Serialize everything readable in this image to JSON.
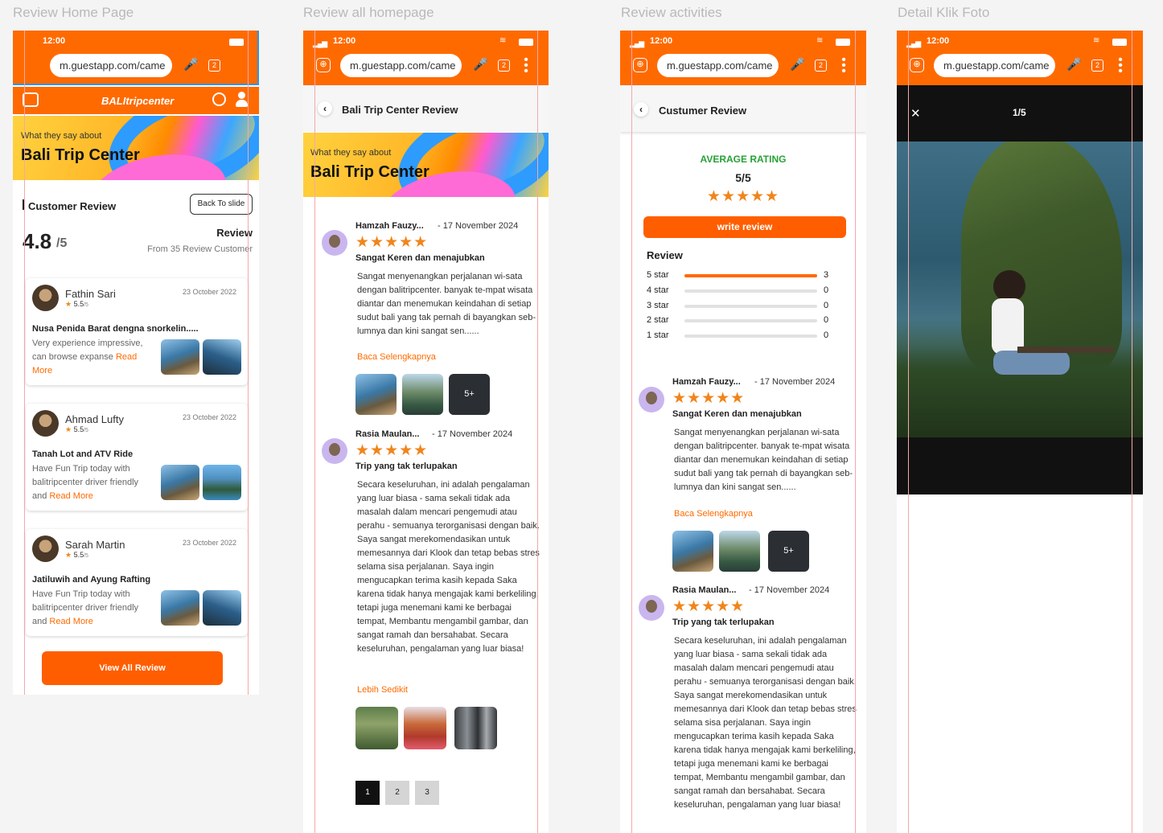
{
  "frames": {
    "f1": "Review Home Page",
    "f2": "Review all homepage",
    "f3": "Review activities",
    "f4": "Detail Klik Foto"
  },
  "status": {
    "time": "12:00",
    "url": "m.guestapp.com/came",
    "tabs": "2"
  },
  "home": {
    "logo": "BALItripcenter",
    "hero_small": "What they say about",
    "hero_big": "Bali Trip Center",
    "section_title": "Customer Review",
    "back_button": "Back To slide",
    "rating": "4.8",
    "rating_max": "/5",
    "review_label": "Review",
    "review_count": "From 35 Review Customer",
    "read_more": "Read More",
    "view_all": "View All Review",
    "cards": [
      {
        "name": "Fathin Sari",
        "date": "23 October 2022",
        "score": "5.5",
        "score_max": "/5",
        "title": "Nusa Penida Barat dengna snorkelin.....",
        "text": "Very experience impressive, can browse expanse"
      },
      {
        "name": "Ahmad Lufty",
        "date": "23 October 2022",
        "score": "5.5",
        "score_max": "/5",
        "title": "Tanah Lot and ATV Ride",
        "text": "Have Fun Trip today with balitripcenter driver friendly and"
      },
      {
        "name": "Sarah Martin",
        "date": "23 October 2022",
        "score": "5.5",
        "score_max": "/5",
        "title": "Jatiluwih and Ayung Rafting",
        "text": "Have Fun Trip today with balitripcenter driver friendly and"
      }
    ]
  },
  "allreview": {
    "header": "Bali Trip Center Review",
    "hero_small": "What they say about",
    "hero_big": "Bali Trip Center",
    "reviews": [
      {
        "name": "Hamzah Fauzy...",
        "date": "- 17 November 2024",
        "stars": "★★★★★",
        "title": "Sangat Keren dan menajubkan",
        "text": "Sangat menyenangkan perjalanan wi-sata dengan balitripcenter. banyak te-mpat wisata diantar dan menemukan keindahan di setiap sudut bali yang tak pernah di bayangkan seb-lumnya dan kini sangat sen......",
        "link": "Baca Selengkapnya",
        "more": "5+"
      },
      {
        "name": "Rasia Maulan...",
        "date": "- 17 November 2024",
        "stars": "★★★★★",
        "title": "Trip yang tak terlupakan",
        "text": "Secara keseluruhan, ini adalah pengalaman yang luar biasa - sama sekali tidak ada masalah dalam mencari pengemudi atau perahu - semuanya terorganisasi dengan baik. Saya sangat merekomendasikan untuk memesannya dari Klook dan tetap bebas stres selama sisa perjalanan. Saya ingin mengucapkan terima kasih kepada Saka karena tidak hanya mengajak kami berkeliling, tetapi juga menemani kami ke berbagai tempat, Membantu mengambil gambar, dan sangat ramah dan bersahabat. Secara keseluruhan, pengalaman yang luar biasa!",
        "link": "Lebih Sedikit"
      }
    ],
    "pages": [
      "1",
      "2",
      "3"
    ]
  },
  "activities": {
    "header": "Custumer Review",
    "avg_label": "AVERAGE RATING",
    "avg_value": "5/5",
    "stars": "★★★★★",
    "write": "write review",
    "review_label": "Review",
    "breakdown": [
      {
        "label": "5 star",
        "count": "3",
        "fraction": 1
      },
      {
        "label": "4 star",
        "count": "0",
        "fraction": 0
      },
      {
        "label": "3 star",
        "count": "0",
        "fraction": 0
      },
      {
        "label": "2 star",
        "count": "0",
        "fraction": 0
      },
      {
        "label": "1 star",
        "count": "0",
        "fraction": 0
      }
    ],
    "reviews": [
      {
        "name": "Hamzah Fauzy...",
        "date": "- 17 November 2024",
        "stars": "★★★★★",
        "title": "Sangat Keren dan menajubkan",
        "text": "Sangat menyenangkan perjalanan wi-sata dengan balitripcenter. banyak te-mpat wisata diantar dan menemukan keindahan di setiap sudut bali yang tak pernah di bayangkan seb-lumnya dan kini sangat sen......",
        "link": "Baca Selengkapnya",
        "more": "5+"
      },
      {
        "name": "Rasia Maulan...",
        "date": "- 17 November 2024",
        "stars": "★★★★★",
        "title": "Trip yang tak terlupakan",
        "text": "Secara keseluruhan, ini adalah pengalaman yang luar biasa - sama sekali tidak ada masalah dalam mencari pengemudi atau perahu - semuanya terorganisasi dengan baik. Saya sangat merekomendasikan untuk memesannya dari Klook dan tetap bebas stres selama sisa perjalanan. Saya ingin mengucapkan terima kasih kepada Saka karena tidak hanya mengajak kami berkeliling, tetapi juga menemani kami ke berbagai tempat, Membantu mengambil gambar, dan sangat ramah dan bersahabat. Secara keseluruhan, pengalaman yang luar biasa!"
      }
    ]
  },
  "photo": {
    "close": "✕",
    "counter": "1/5"
  },
  "colors": {
    "brand": "#ff6a00",
    "star": "#f0851b",
    "link": "#ff6a00"
  },
  "icons": [
    "menu-icon",
    "globe-icon",
    "user-icon",
    "mic-icon",
    "add-tab-icon",
    "back-chevron-icon",
    "close-icon",
    "star-icon"
  ]
}
